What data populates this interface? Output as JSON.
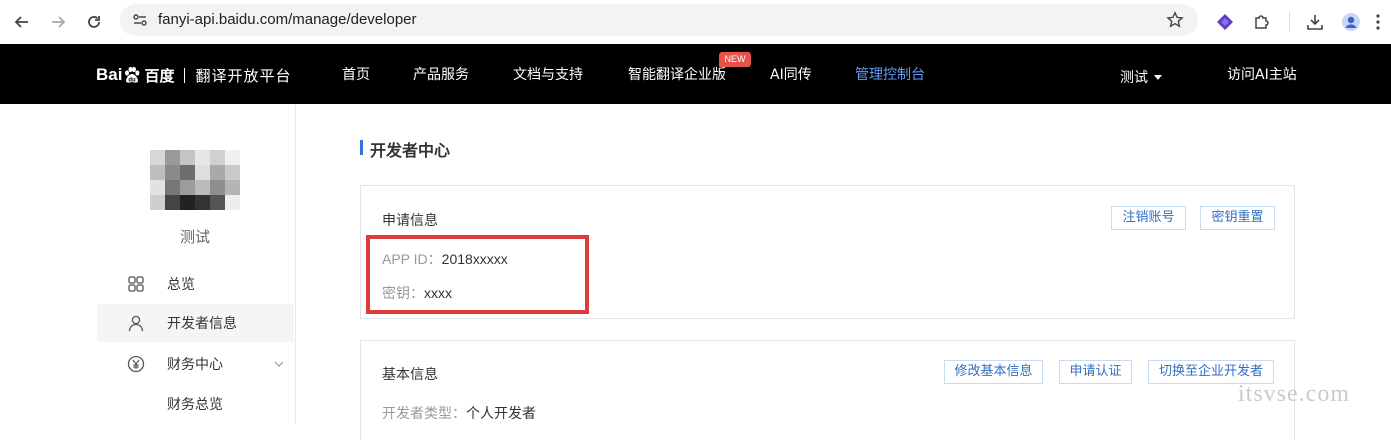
{
  "browser": {
    "url": "fanyi-api.baidu.com/manage/developer"
  },
  "header": {
    "logo_bai": "Bai",
    "logo_du": "du",
    "logo_cn": "百度",
    "logo_title": "翻译开放平台",
    "nav": [
      {
        "label": "首页"
      },
      {
        "label": "产品服务"
      },
      {
        "label": "文档与支持"
      },
      {
        "label": "智能翻译企业版"
      },
      {
        "label": "AI同传"
      },
      {
        "label": "管理控制台"
      }
    ],
    "new_badge": "NEW",
    "user_menu": "测试",
    "visit_ai": "访问AI主站",
    "active_color": "#5f9cff"
  },
  "sidebar": {
    "username": "测试",
    "items": [
      {
        "label": "总览",
        "icon": "grid-icon"
      },
      {
        "label": "开发者信息",
        "icon": "user-icon"
      },
      {
        "label": "财务中心",
        "icon": "yen-circle-icon"
      },
      {
        "label": "财务总览"
      }
    ]
  },
  "main": {
    "title": "开发者中心",
    "apply_card": {
      "title": "申请信息",
      "buttons": [
        "注销账号",
        "密钥重置"
      ],
      "app_id_label": "APP ID：",
      "app_id_value": "2018xxxxx",
      "key_label": "密钥：",
      "key_value": "xxxx"
    },
    "basic_card": {
      "title": "基本信息",
      "buttons": [
        "修改基本信息",
        "申请认证",
        "切换至企业开发者"
      ],
      "dev_type_label": "开发者类型：",
      "dev_type_value": "个人开发者"
    }
  },
  "watermark": "itsvse.com",
  "colors": {
    "accent": "#3275d5",
    "highlight": "#e03b3b",
    "button_text": "#2f6fc2"
  }
}
